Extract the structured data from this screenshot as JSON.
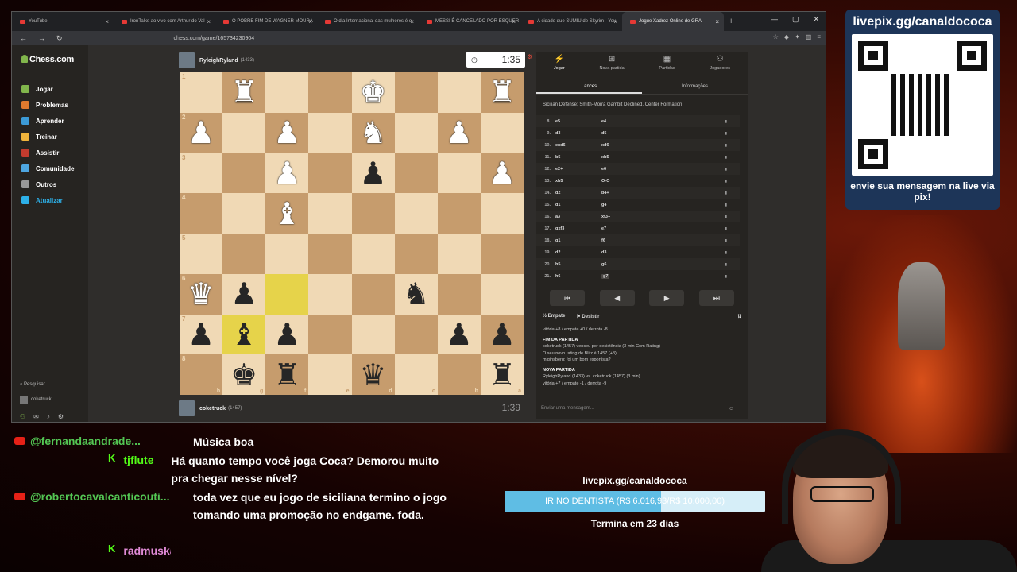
{
  "browser": {
    "tabs": [
      {
        "label": "YouTube",
        "active": false
      },
      {
        "label": "IronTalks ao vivo com Arthur do Val",
        "active": false
      },
      {
        "label": "O POBRE FIM DE WAGNER MOURA",
        "active": false
      },
      {
        "label": "O dia Internacional das mulheres é o",
        "active": false
      },
      {
        "label": "MESSI É CANCELADO POR ESQUER",
        "active": false
      },
      {
        "label": "A cidade que SUMIU de Skyrim - You",
        "active": false
      },
      {
        "label": "Jogue Xadrez Online de GRA",
        "active": true
      }
    ],
    "url": "chess.com/game/165734230904"
  },
  "sidebar": {
    "logo": "Chess.com",
    "items": [
      {
        "label": "Jogar",
        "color": "#81b64c"
      },
      {
        "label": "Problemas",
        "color": "#e07a2e"
      },
      {
        "label": "Aprender",
        "color": "#3c9ad6"
      },
      {
        "label": "Treinar",
        "color": "#f0b43c"
      },
      {
        "label": "Assistir",
        "color": "#c23b2e"
      },
      {
        "label": "Comunidade",
        "color": "#4ea6e0"
      },
      {
        "label": "Outros",
        "color": "#999999"
      },
      {
        "label": "Atualizar",
        "color": "#2db0e8"
      }
    ],
    "search": "Pesquisar",
    "user": "coketruck"
  },
  "top_player": {
    "name": "RyleighRyland",
    "rating": "(1433)",
    "clock": "1:35"
  },
  "bottom_player": {
    "name": "coketruck",
    "rating": "(1457)",
    "clock": "1:39"
  },
  "board": {
    "ranks": [
      "1",
      "2",
      "3",
      "4",
      "5",
      "6",
      "7",
      "8"
    ],
    "files": [
      "h",
      "g",
      "f",
      "e",
      "d",
      "c",
      "b",
      "a"
    ],
    "rows": [
      [
        "",
        "wR",
        "",
        "",
        "wK",
        "",
        "",
        "wR"
      ],
      [
        "wP",
        "",
        "wP",
        "",
        "wN",
        "",
        "wP",
        ""
      ],
      [
        "",
        "",
        "wP",
        "",
        "bP",
        "",
        "",
        "wP"
      ],
      [
        "",
        "",
        "wB",
        "",
        "",
        "",
        "",
        ""
      ],
      [
        "",
        "",
        "",
        "",
        "",
        "",
        "",
        ""
      ],
      [
        "wQ",
        "bP",
        "",
        "",
        "",
        "bN",
        "",
        ""
      ],
      [
        "bP",
        "bB",
        "bP",
        "",
        "",
        "",
        "bP",
        "bP"
      ],
      [
        "",
        "bK",
        "bR",
        "",
        "bQ",
        "",
        "",
        "bR"
      ]
    ],
    "highlights": [
      "6-2",
      "7-1"
    ]
  },
  "panel": {
    "tabs": [
      "Jogar",
      "Nova partida",
      "Partidas",
      "Jogadores"
    ],
    "subtabs": [
      "Lances",
      "Informações"
    ],
    "opening": "Sicilian Defense: Smith-Morra Gambit Declined, Center Formation",
    "moves": [
      {
        "n": "8.",
        "w": "e5",
        "b": "e4"
      },
      {
        "n": "9.",
        "w": "d3",
        "b": "d5"
      },
      {
        "n": "10.",
        "w": "exd6",
        "b": "xd6"
      },
      {
        "n": "11.",
        "w": "b5",
        "b": "xb5"
      },
      {
        "n": "12.",
        "w": "e2+",
        "b": "e6"
      },
      {
        "n": "13.",
        "w": "xb5",
        "b": "O-O"
      },
      {
        "n": "14.",
        "w": "d2",
        "b": "b4+"
      },
      {
        "n": "15.",
        "w": "d1",
        "b": "g4"
      },
      {
        "n": "16.",
        "w": "a3",
        "b": "xf3+"
      },
      {
        "n": "17.",
        "w": "gxf3",
        "b": "e7"
      },
      {
        "n": "18.",
        "w": "g1",
        "b": "f6"
      },
      {
        "n": "19.",
        "w": "d2",
        "b": "d3"
      },
      {
        "n": "20.",
        "w": "h5",
        "b": "g6"
      },
      {
        "n": "21.",
        "w": "h6",
        "b": "g7"
      }
    ],
    "draw": "Empate",
    "resign": "Desistir",
    "log": [
      {
        "text": "vitória +8 / empate +0 / derrota -8",
        "head": false
      },
      {
        "text": "FIM DA PARTIDA",
        "head": true
      },
      {
        "text": "coketruck (1457) venceu por desistência (3 min Com Rating)",
        "head": false
      },
      {
        "text": "O seu novo rating de Blitz é 1457 (+8).",
        "head": false
      },
      {
        "text": "mjginsberg: foi um bom esportista?",
        "head": false
      },
      {
        "text": "NOVA PARTIDA",
        "head": true
      },
      {
        "text": "RyleighRyland (1433) vs. coketruck (1457) (3 min)",
        "head": false
      },
      {
        "text": "vitória +7 / empate -1 / derrota -9",
        "head": false
      }
    ],
    "chat_placeholder": "Enviar uma mensagem..."
  },
  "qr": {
    "title": "livepix.gg/canaldococa",
    "caption": "envie sua mensagem na live via pix!"
  },
  "chat": [
    {
      "user": "@fernandaandrade...",
      "platform": "youtube",
      "color": "#53c653",
      "msg": "Música boa"
    },
    {
      "user": "tjflute",
      "platform": "kick",
      "color": "#53fc18",
      "msg": "Há quanto tempo você joga Coca? Demorou muito pra chegar nesse nível?"
    },
    {
      "user": "@robertocavalcanticouti...",
      "platform": "youtube",
      "color": "#53c653",
      "msg": "toda vez que eu jogo de siciliana termino o jogo tomando uma promoção no endgame. foda."
    },
    {
      "user": "radmuskai",
      "platform": "kick",
      "color": "#e08ad6",
      "msg": ""
    }
  ],
  "goal": {
    "handle": "livepix.gg/canaldococa",
    "label": "IR NO DENTISTA (R$ 6.016,93/R$ 10.000,00)",
    "progress": 0.6017,
    "days": "Termina em 23 dias"
  },
  "colors": {
    "accent": "#81b64c",
    "board_light": "#f0d9b5",
    "board_dark": "#c69c6d",
    "highlight": "#e6d34a"
  }
}
